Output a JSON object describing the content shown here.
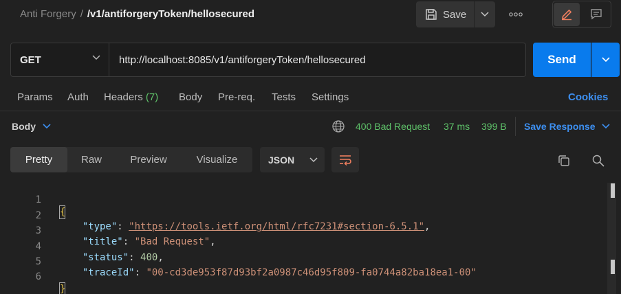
{
  "header": {
    "breadcrumb_parent": "Anti Forgery",
    "breadcrumb_separator": "/",
    "breadcrumb_current": "/v1/antiforgeryToken/hellosecured",
    "save_label": "Save",
    "more_label": "ooo"
  },
  "request": {
    "method": "GET",
    "url": "http://localhost:8085/v1/antiforgeryToken/hellosecured",
    "send_label": "Send"
  },
  "request_tabs": {
    "params": "Params",
    "auth": "Auth",
    "headers": "Headers",
    "headers_count": "(7)",
    "body": "Body",
    "prereq": "Pre-req.",
    "tests": "Tests",
    "settings": "Settings",
    "cookies": "Cookies"
  },
  "response": {
    "body_label": "Body",
    "status": "400 Bad Request",
    "time": "37 ms",
    "size": "399 B",
    "save_response": "Save Response",
    "view_tabs": [
      "Pretty",
      "Raw",
      "Preview",
      "Visualize"
    ],
    "active_view": "Pretty",
    "format": "JSON"
  },
  "code": {
    "line_numbers": [
      "1",
      "2",
      "3",
      "4",
      "5",
      "6"
    ],
    "open_brace": "{",
    "close_brace": "}",
    "type_key": "\"type\"",
    "type_value": "\"https://tools.ietf.org/html/rfc7231#section-6.5.1\"",
    "title_key": "\"title\"",
    "title_value": "\"Bad Request\"",
    "status_key": "\"status\"",
    "status_value": "400",
    "traceid_key": "\"traceId\"",
    "traceid_value": "\"00-cd3de953f87d93bf2a0987c46d95f809-fa0744a82ba18ea1-00\""
  },
  "colors": {
    "accent_blue": "#097bed",
    "success_green": "#5fc36a",
    "edit_orange": "#f07f5f"
  },
  "icons": [
    "save-icon",
    "chevron-down-icon",
    "more-icon",
    "pencil-icon",
    "comment-icon",
    "globe-icon",
    "wrap-lines-icon",
    "copy-icon",
    "search-icon"
  ]
}
